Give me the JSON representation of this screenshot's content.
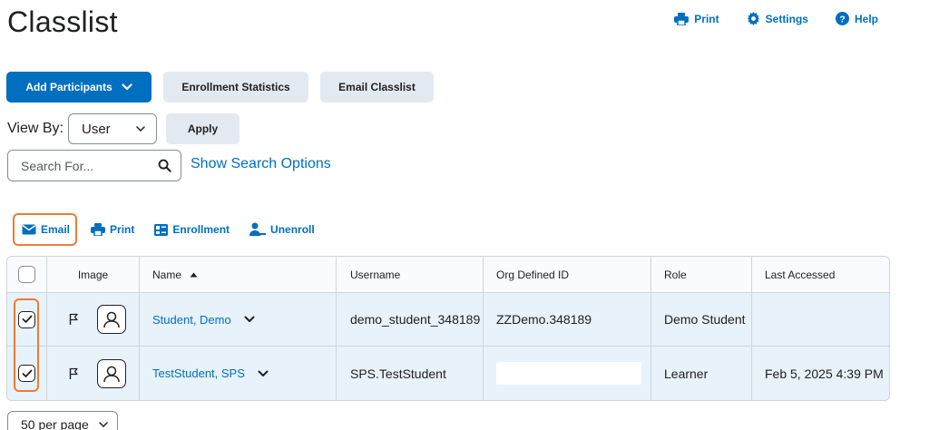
{
  "page": {
    "title": "Classlist"
  },
  "top_actions": {
    "print": "Print",
    "settings": "Settings",
    "help": "Help"
  },
  "buttons": {
    "add_participants": "Add Participants",
    "enrollment_statistics": "Enrollment Statistics",
    "email_classlist": "Email Classlist",
    "apply": "Apply"
  },
  "view_by": {
    "label": "View By:",
    "value": "User"
  },
  "search": {
    "placeholder": "Search For...",
    "show_options": "Show Search Options"
  },
  "toolbar": {
    "email": "Email",
    "print": "Print",
    "enrollment": "Enrollment",
    "unenroll": "Unenroll"
  },
  "table": {
    "headers": {
      "image": "Image",
      "name": "Name",
      "username": "Username",
      "org_id": "Org Defined ID",
      "role": "Role",
      "last_accessed": "Last Accessed"
    },
    "rows": [
      {
        "name": "Student, Demo",
        "username": "demo_student_348189",
        "org_id": "ZZDemo.348189",
        "role": "Demo Student",
        "last_accessed": "",
        "checked": true
      },
      {
        "name": "TestStudent, SPS",
        "username": "SPS.TestStudent",
        "org_id": "",
        "role": "Learner",
        "last_accessed": "Feb 5, 2025 4:39 PM",
        "checked": true
      }
    ]
  },
  "pagination": {
    "per_page": "50 per page"
  },
  "colors": {
    "accent": "#006fbf",
    "highlight": "#ea7d35",
    "selected_row": "#e8f2fa"
  }
}
